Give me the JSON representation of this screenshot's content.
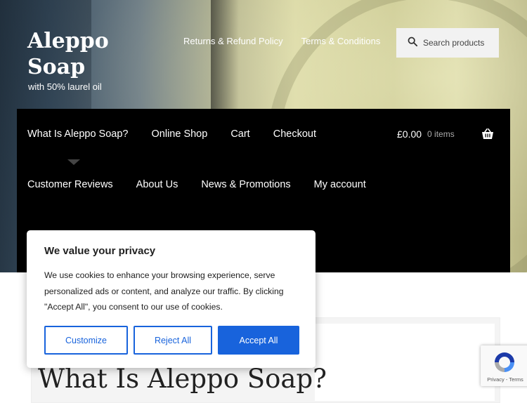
{
  "site": {
    "title": "Aleppo Soap",
    "tagline": "with 50% laurel oil"
  },
  "top_links": [
    "Returns & Refund Policy",
    "Terms & Conditions"
  ],
  "search": {
    "placeholder": "Search products"
  },
  "nav": {
    "row1": [
      "What Is Aleppo Soap?",
      "Online Shop",
      "Cart",
      "Checkout"
    ],
    "row2": [
      "Customer Reviews",
      "About Us",
      "News & Promotions",
      "My account"
    ]
  },
  "cart": {
    "amount": "£0.00",
    "count": "0 items"
  },
  "page": {
    "title": "What Is Aleppo Soap?"
  },
  "cookie": {
    "heading": "We value your privacy",
    "body": "We use cookies to enhance your browsing experience, serve personalized ads or content, and analyze our traffic. By clicking \"Accept All\", you consent to our use of cookies.",
    "customize": "Customize",
    "reject": "Reject All",
    "accept": "Accept All",
    "accent_color": "#1863dc"
  },
  "recaptcha": {
    "terms": "Privacy - Terms"
  }
}
